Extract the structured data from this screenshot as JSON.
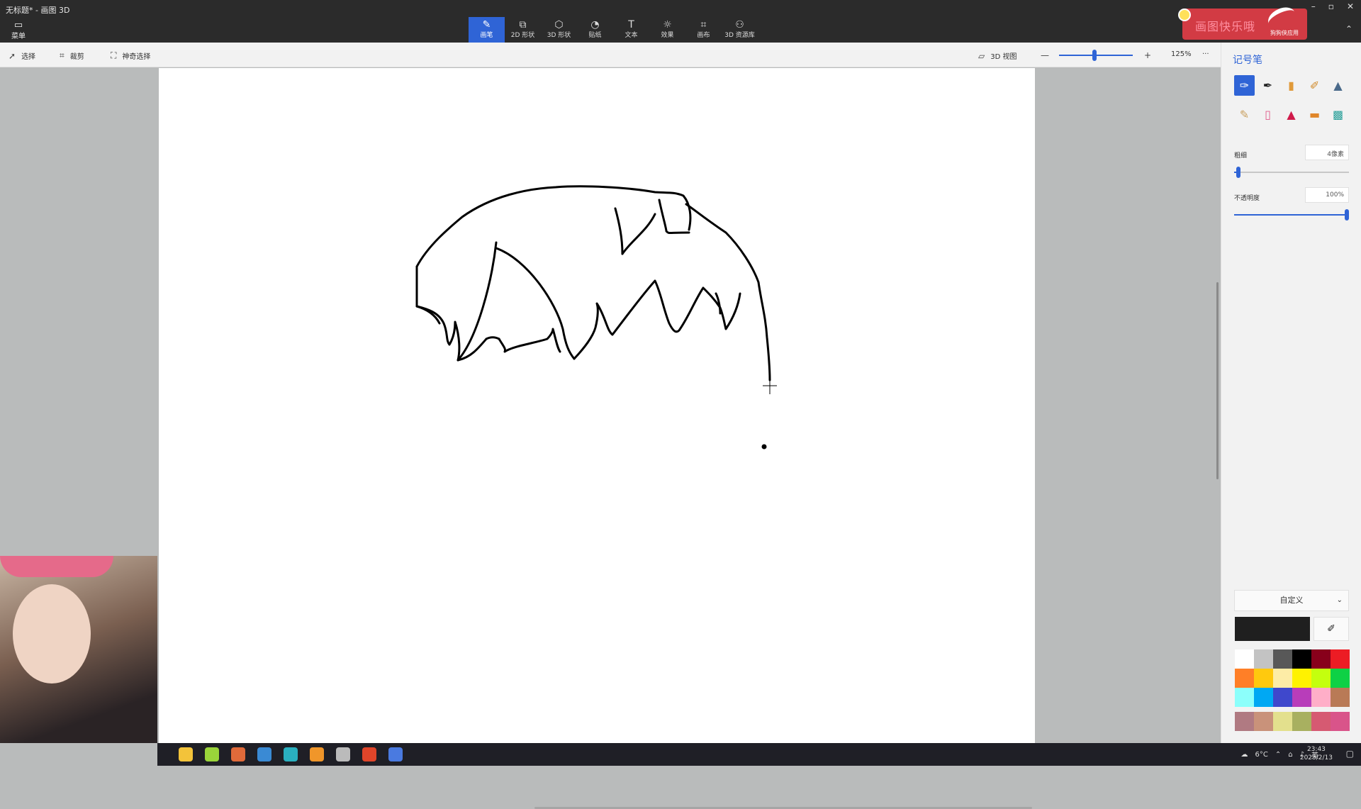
{
  "window": {
    "title": "无标题* - 画图 3D",
    "menu_label": "菜单"
  },
  "tools": [
    {
      "label": "画笔",
      "icon": "brush-icon",
      "active": true
    },
    {
      "label": "2D 形状",
      "icon": "2d-shapes-icon"
    },
    {
      "label": "3D 形状",
      "icon": "3d-shapes-icon"
    },
    {
      "label": "贴纸",
      "icon": "stickers-icon"
    },
    {
      "label": "文本",
      "icon": "text-icon"
    },
    {
      "label": "效果",
      "icon": "effects-icon"
    },
    {
      "label": "画布",
      "icon": "canvas-icon"
    },
    {
      "label": "3D 资源库",
      "icon": "3d-library-icon"
    }
  ],
  "ad_badge": {
    "text": "画图快乐哦",
    "sub": "狗狗侠应用"
  },
  "toolbar2": {
    "select": "选择",
    "crop": "裁剪",
    "magic_select": "神奇选择",
    "view3d": "3D 视图",
    "zoom": "125%",
    "zoom_fraction": 0.48,
    "more": "···"
  },
  "panel": {
    "title": "记号笔",
    "thickness_label": "粗细",
    "thickness_value": "4像素",
    "thickness_fraction": 0.04,
    "opacity_label": "不透明度",
    "opacity_value": "100%",
    "opacity_fraction": 1.0,
    "color_mode": "自定义",
    "current_color": "#1f1f1f",
    "brushes": [
      "marker-icon",
      "calligraphy-pen-icon",
      "oil-brush-icon",
      "watercolor-icon",
      "pixel-pen-icon",
      "pencil-icon",
      "eraser-icon",
      "crayon-icon",
      "spray-can-icon",
      "fill-icon"
    ],
    "palette": [
      "#ffffff",
      "#c3c3c3",
      "#585858",
      "#000000",
      "#88001b",
      "#ec1c24",
      "#ff7f27",
      "#ffc90e",
      "#fdeca6",
      "#fff200",
      "#c4ff0e",
      "#0ed145",
      "#8cfffb",
      "#00a8f3",
      "#3f48cc",
      "#b83dba",
      "#ffaec8",
      "#b97a56"
    ],
    "custom_palette": [
      "#b07a82",
      "#c9927a",
      "#e3e08d",
      "#a8b060",
      "#d65a72",
      "#d9548a"
    ]
  },
  "taskbar": {
    "weather": "6°C",
    "lang": "英",
    "time": "23:43",
    "date": "2023/2/13",
    "apps": [
      "#f3c33a",
      "#9ad43a",
      "#e06a3a",
      "#3a8ad4",
      "#2ab0c0",
      "#f0962a",
      "#bbbbbb",
      "#e0452a",
      "#4a7ae0"
    ]
  }
}
